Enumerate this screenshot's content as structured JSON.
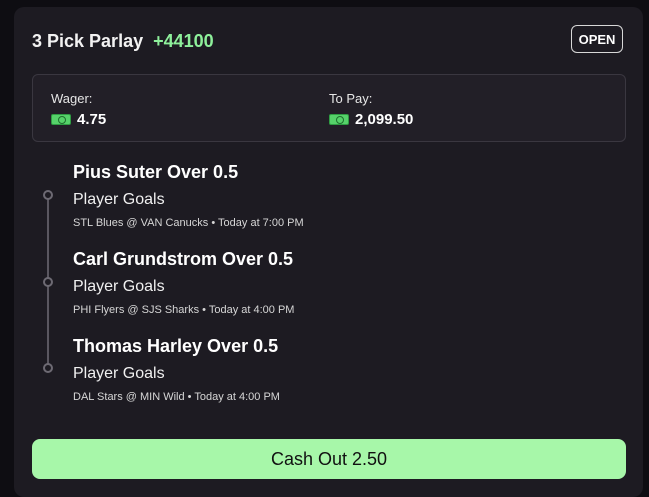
{
  "bet": {
    "title": "3 Pick Parlay",
    "odds": "+44100",
    "status": "OPEN"
  },
  "summary": {
    "wager_label": "Wager:",
    "wager_value": "4.75",
    "payout_label": "To Pay:",
    "payout_value": "2,099.50",
    "currency_icon": "cash-icon"
  },
  "legs": [
    {
      "title": "Pius Suter Over 0.5",
      "market": "Player Goals",
      "game": "STL Blues @ VAN Canucks • Today at 7:00 PM"
    },
    {
      "title": "Carl Grundstrom Over 0.5",
      "market": "Player Goals",
      "game": "PHI Flyers @ SJS Sharks • Today at 4:00 PM"
    },
    {
      "title": "Thomas Harley Over 0.5",
      "market": "Player Goals",
      "game": "DAL Stars @ MIN Wild • Today at 4:00 PM"
    }
  ],
  "cashout": {
    "label": "Cash Out 2.50"
  },
  "colors": {
    "background": "#1d1b22",
    "odds": "#8ef09b",
    "cashout_button": "#a7f7a9"
  }
}
